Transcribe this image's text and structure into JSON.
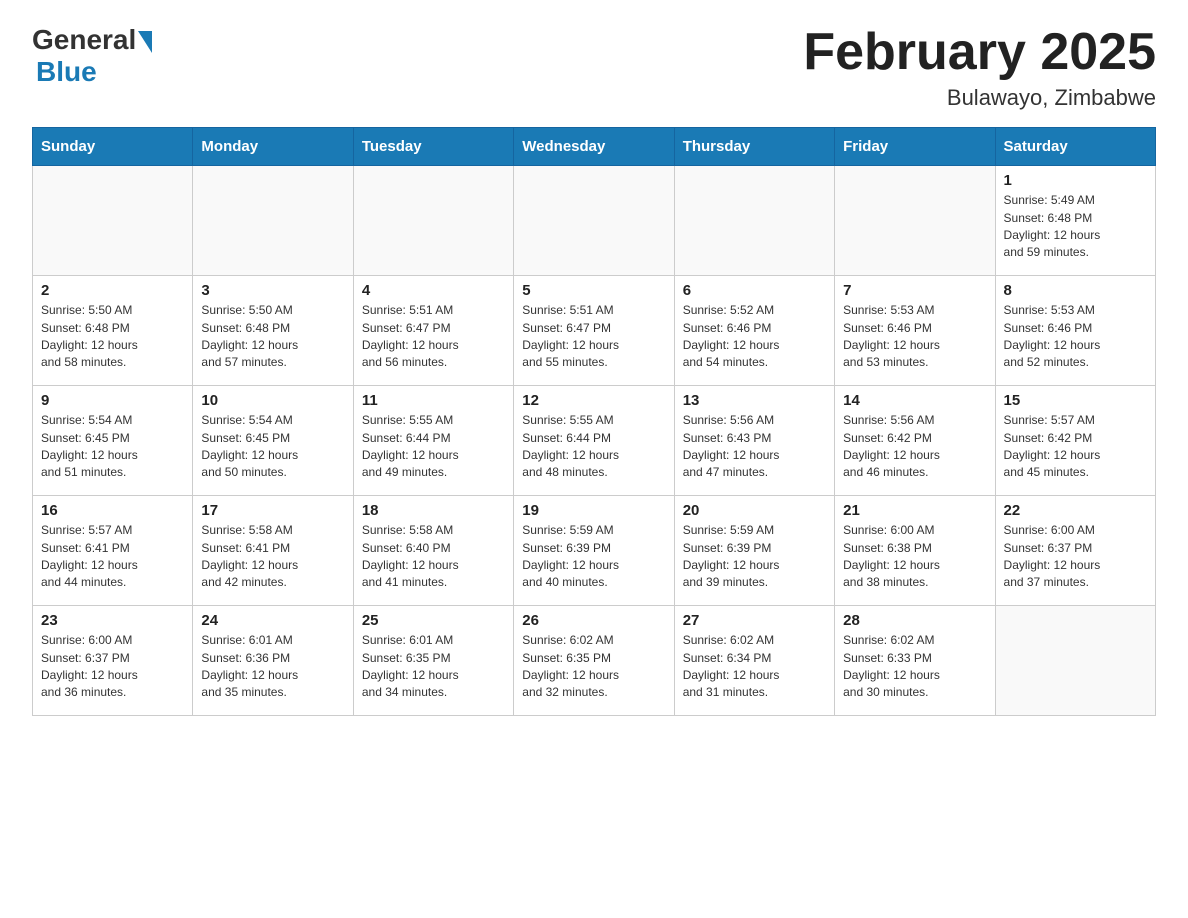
{
  "logo": {
    "general": "General",
    "blue": "Blue"
  },
  "title": "February 2025",
  "subtitle": "Bulawayo, Zimbabwe",
  "weekdays": [
    "Sunday",
    "Monday",
    "Tuesday",
    "Wednesday",
    "Thursday",
    "Friday",
    "Saturday"
  ],
  "weeks": [
    [
      {
        "day": "",
        "info": ""
      },
      {
        "day": "",
        "info": ""
      },
      {
        "day": "",
        "info": ""
      },
      {
        "day": "",
        "info": ""
      },
      {
        "day": "",
        "info": ""
      },
      {
        "day": "",
        "info": ""
      },
      {
        "day": "1",
        "info": "Sunrise: 5:49 AM\nSunset: 6:48 PM\nDaylight: 12 hours\nand 59 minutes."
      }
    ],
    [
      {
        "day": "2",
        "info": "Sunrise: 5:50 AM\nSunset: 6:48 PM\nDaylight: 12 hours\nand 58 minutes."
      },
      {
        "day": "3",
        "info": "Sunrise: 5:50 AM\nSunset: 6:48 PM\nDaylight: 12 hours\nand 57 minutes."
      },
      {
        "day": "4",
        "info": "Sunrise: 5:51 AM\nSunset: 6:47 PM\nDaylight: 12 hours\nand 56 minutes."
      },
      {
        "day": "5",
        "info": "Sunrise: 5:51 AM\nSunset: 6:47 PM\nDaylight: 12 hours\nand 55 minutes."
      },
      {
        "day": "6",
        "info": "Sunrise: 5:52 AM\nSunset: 6:46 PM\nDaylight: 12 hours\nand 54 minutes."
      },
      {
        "day": "7",
        "info": "Sunrise: 5:53 AM\nSunset: 6:46 PM\nDaylight: 12 hours\nand 53 minutes."
      },
      {
        "day": "8",
        "info": "Sunrise: 5:53 AM\nSunset: 6:46 PM\nDaylight: 12 hours\nand 52 minutes."
      }
    ],
    [
      {
        "day": "9",
        "info": "Sunrise: 5:54 AM\nSunset: 6:45 PM\nDaylight: 12 hours\nand 51 minutes."
      },
      {
        "day": "10",
        "info": "Sunrise: 5:54 AM\nSunset: 6:45 PM\nDaylight: 12 hours\nand 50 minutes."
      },
      {
        "day": "11",
        "info": "Sunrise: 5:55 AM\nSunset: 6:44 PM\nDaylight: 12 hours\nand 49 minutes."
      },
      {
        "day": "12",
        "info": "Sunrise: 5:55 AM\nSunset: 6:44 PM\nDaylight: 12 hours\nand 48 minutes."
      },
      {
        "day": "13",
        "info": "Sunrise: 5:56 AM\nSunset: 6:43 PM\nDaylight: 12 hours\nand 47 minutes."
      },
      {
        "day": "14",
        "info": "Sunrise: 5:56 AM\nSunset: 6:42 PM\nDaylight: 12 hours\nand 46 minutes."
      },
      {
        "day": "15",
        "info": "Sunrise: 5:57 AM\nSunset: 6:42 PM\nDaylight: 12 hours\nand 45 minutes."
      }
    ],
    [
      {
        "day": "16",
        "info": "Sunrise: 5:57 AM\nSunset: 6:41 PM\nDaylight: 12 hours\nand 44 minutes."
      },
      {
        "day": "17",
        "info": "Sunrise: 5:58 AM\nSunset: 6:41 PM\nDaylight: 12 hours\nand 42 minutes."
      },
      {
        "day": "18",
        "info": "Sunrise: 5:58 AM\nSunset: 6:40 PM\nDaylight: 12 hours\nand 41 minutes."
      },
      {
        "day": "19",
        "info": "Sunrise: 5:59 AM\nSunset: 6:39 PM\nDaylight: 12 hours\nand 40 minutes."
      },
      {
        "day": "20",
        "info": "Sunrise: 5:59 AM\nSunset: 6:39 PM\nDaylight: 12 hours\nand 39 minutes."
      },
      {
        "day": "21",
        "info": "Sunrise: 6:00 AM\nSunset: 6:38 PM\nDaylight: 12 hours\nand 38 minutes."
      },
      {
        "day": "22",
        "info": "Sunrise: 6:00 AM\nSunset: 6:37 PM\nDaylight: 12 hours\nand 37 minutes."
      }
    ],
    [
      {
        "day": "23",
        "info": "Sunrise: 6:00 AM\nSunset: 6:37 PM\nDaylight: 12 hours\nand 36 minutes."
      },
      {
        "day": "24",
        "info": "Sunrise: 6:01 AM\nSunset: 6:36 PM\nDaylight: 12 hours\nand 35 minutes."
      },
      {
        "day": "25",
        "info": "Sunrise: 6:01 AM\nSunset: 6:35 PM\nDaylight: 12 hours\nand 34 minutes."
      },
      {
        "day": "26",
        "info": "Sunrise: 6:02 AM\nSunset: 6:35 PM\nDaylight: 12 hours\nand 32 minutes."
      },
      {
        "day": "27",
        "info": "Sunrise: 6:02 AM\nSunset: 6:34 PM\nDaylight: 12 hours\nand 31 minutes."
      },
      {
        "day": "28",
        "info": "Sunrise: 6:02 AM\nSunset: 6:33 PM\nDaylight: 12 hours\nand 30 minutes."
      },
      {
        "day": "",
        "info": ""
      }
    ]
  ]
}
